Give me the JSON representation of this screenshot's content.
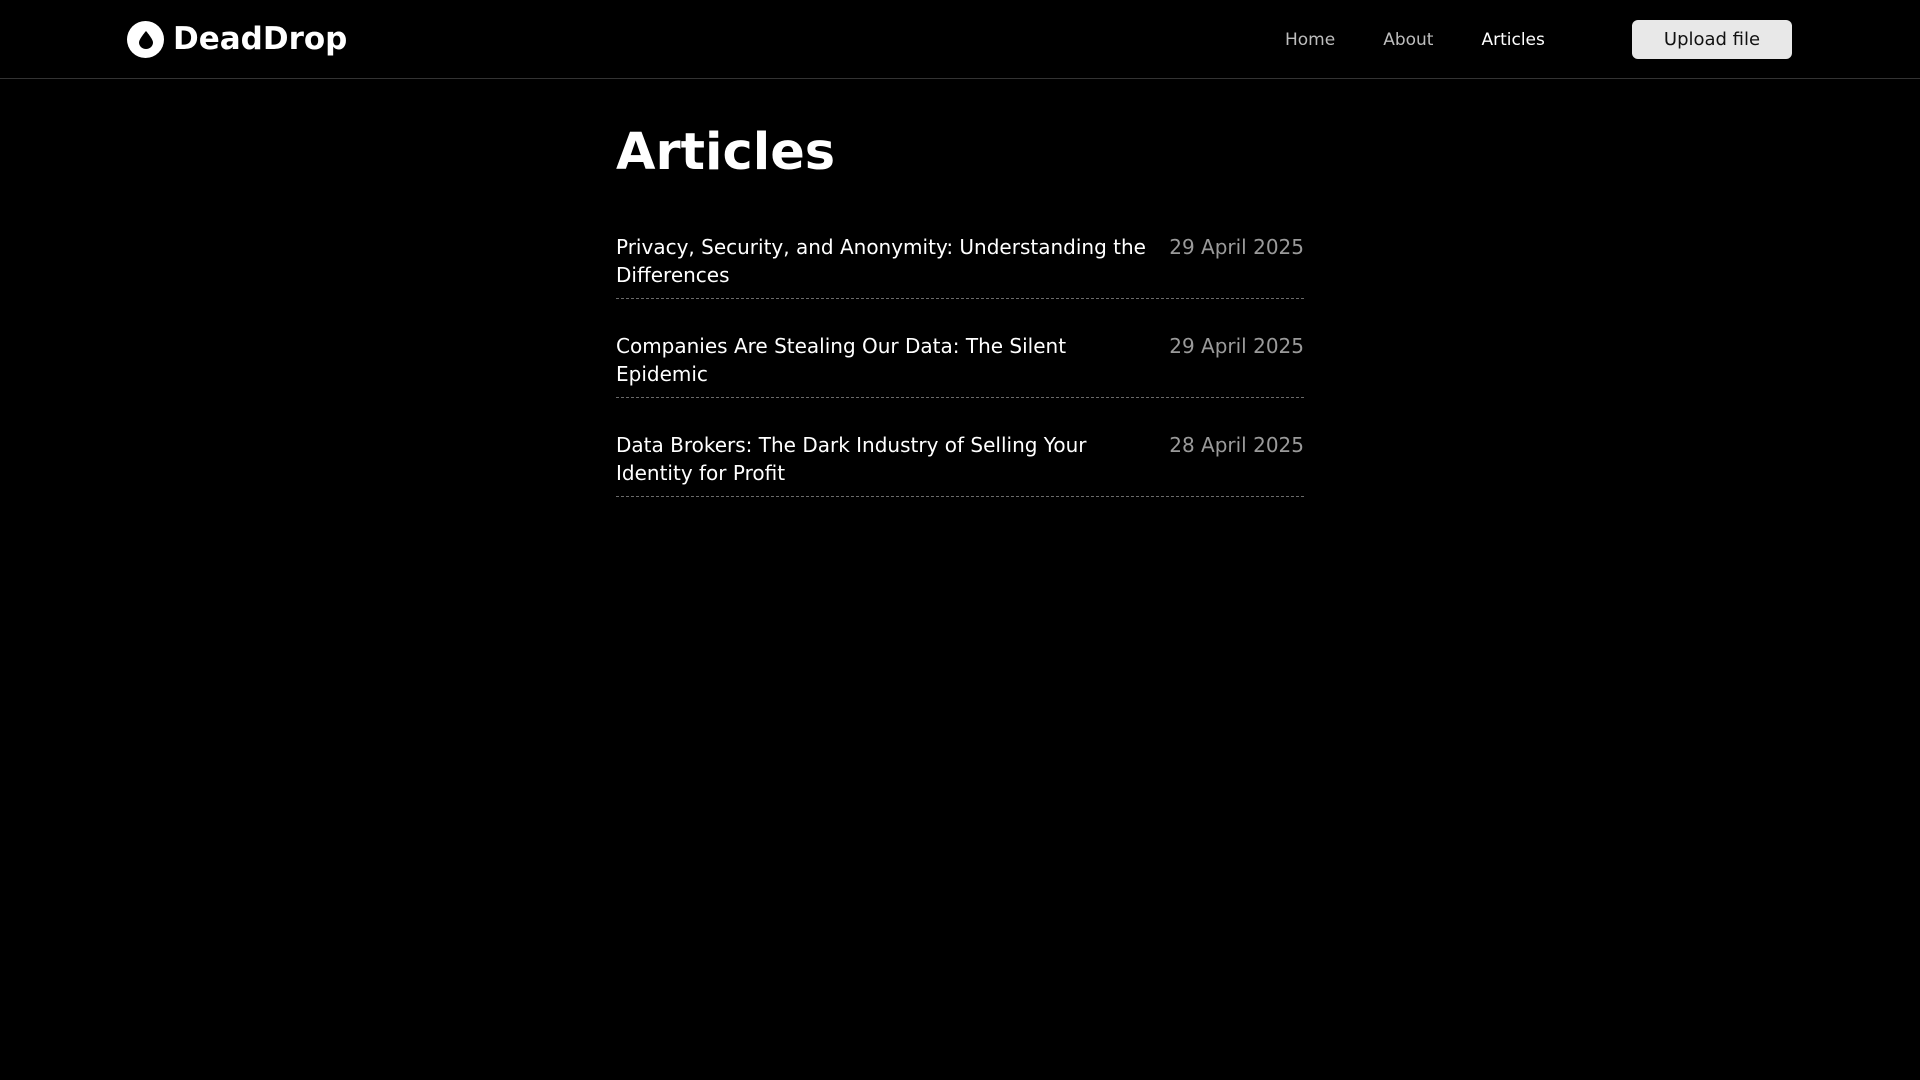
{
  "brand": {
    "name": "DeadDrop",
    "logo_icon": "droplet-icon"
  },
  "nav": {
    "items": [
      {
        "label": "Home",
        "active": false
      },
      {
        "label": "About",
        "active": false
      },
      {
        "label": "Articles",
        "active": true
      }
    ]
  },
  "upload_button": {
    "label": "Upload file"
  },
  "page": {
    "title": "Articles"
  },
  "articles": [
    {
      "title": "Privacy, Security, and Anonymity: Understanding the Differences",
      "date": "29 April 2025"
    },
    {
      "title": "Companies Are Stealing Our Data: The Silent Epidemic",
      "date": "29 April 2025"
    },
    {
      "title": "Data Brokers: The Dark Industry of Selling Your Identity for Profit",
      "date": "28 April 2025"
    }
  ],
  "colors": {
    "background": "#000000",
    "text": "#ffffff",
    "muted": "#9a9a9a",
    "button_bg": "#e8e8e8"
  }
}
